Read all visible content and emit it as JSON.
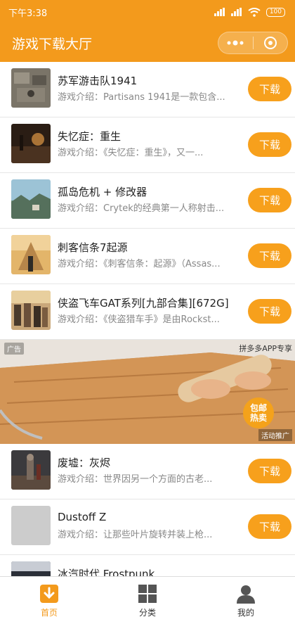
{
  "status": {
    "time": "下午3:38",
    "battery": "100"
  },
  "header": {
    "title": "游戏下载大厅",
    "more_icon": "more-dots-icon",
    "close_icon": "target-circle-icon"
  },
  "games": [
    {
      "name": "苏军游击队1941",
      "desc": "游戏介绍：Partisans 1941是一款包含...",
      "button": "下载"
    },
    {
      "name": "失忆症：重生",
      "desc": "游戏介绍：《失忆症：重生》，又一...",
      "button": "下载"
    },
    {
      "name": "孤岛危机 + 修改器",
      "desc": "游戏介绍：Crytek的经典第一人称射击...",
      "button": "下载"
    },
    {
      "name": "刺客信条7起源",
      "desc": "游戏介绍：《刺客信条：起源》（Assas...",
      "button": "下载"
    },
    {
      "name": "侠盗飞车GAT系列[九部合集][672G]",
      "desc": "游戏介绍：《侠盗猎车手》是由Rockst...",
      "button": "下载"
    }
  ],
  "ad": {
    "tag": "广告",
    "source": "拼多多APP专享",
    "promo": "活动推广",
    "badge_line1": "包邮",
    "badge_line2": "热卖"
  },
  "games_after_ad": [
    {
      "name": "废墟：灰烬",
      "desc": "游戏介绍：世界因另一个方面的古老...",
      "button": "下载"
    },
    {
      "name": "Dustoff Z",
      "desc": "游戏介绍：让那些叶片旋转并装上枪...",
      "button": "下载"
    },
    {
      "name": "冰汽时代 Frostpunk",
      "desc": "",
      "button": ""
    }
  ],
  "tabs": [
    {
      "label": "首页",
      "icon": "download-home-icon",
      "active": true
    },
    {
      "label": "分类",
      "icon": "grid-category-icon",
      "active": false
    },
    {
      "label": "我的",
      "icon": "user-profile-icon",
      "active": false
    }
  ],
  "colors": {
    "brand": "#f39a1c",
    "button": "#f7a01c"
  }
}
